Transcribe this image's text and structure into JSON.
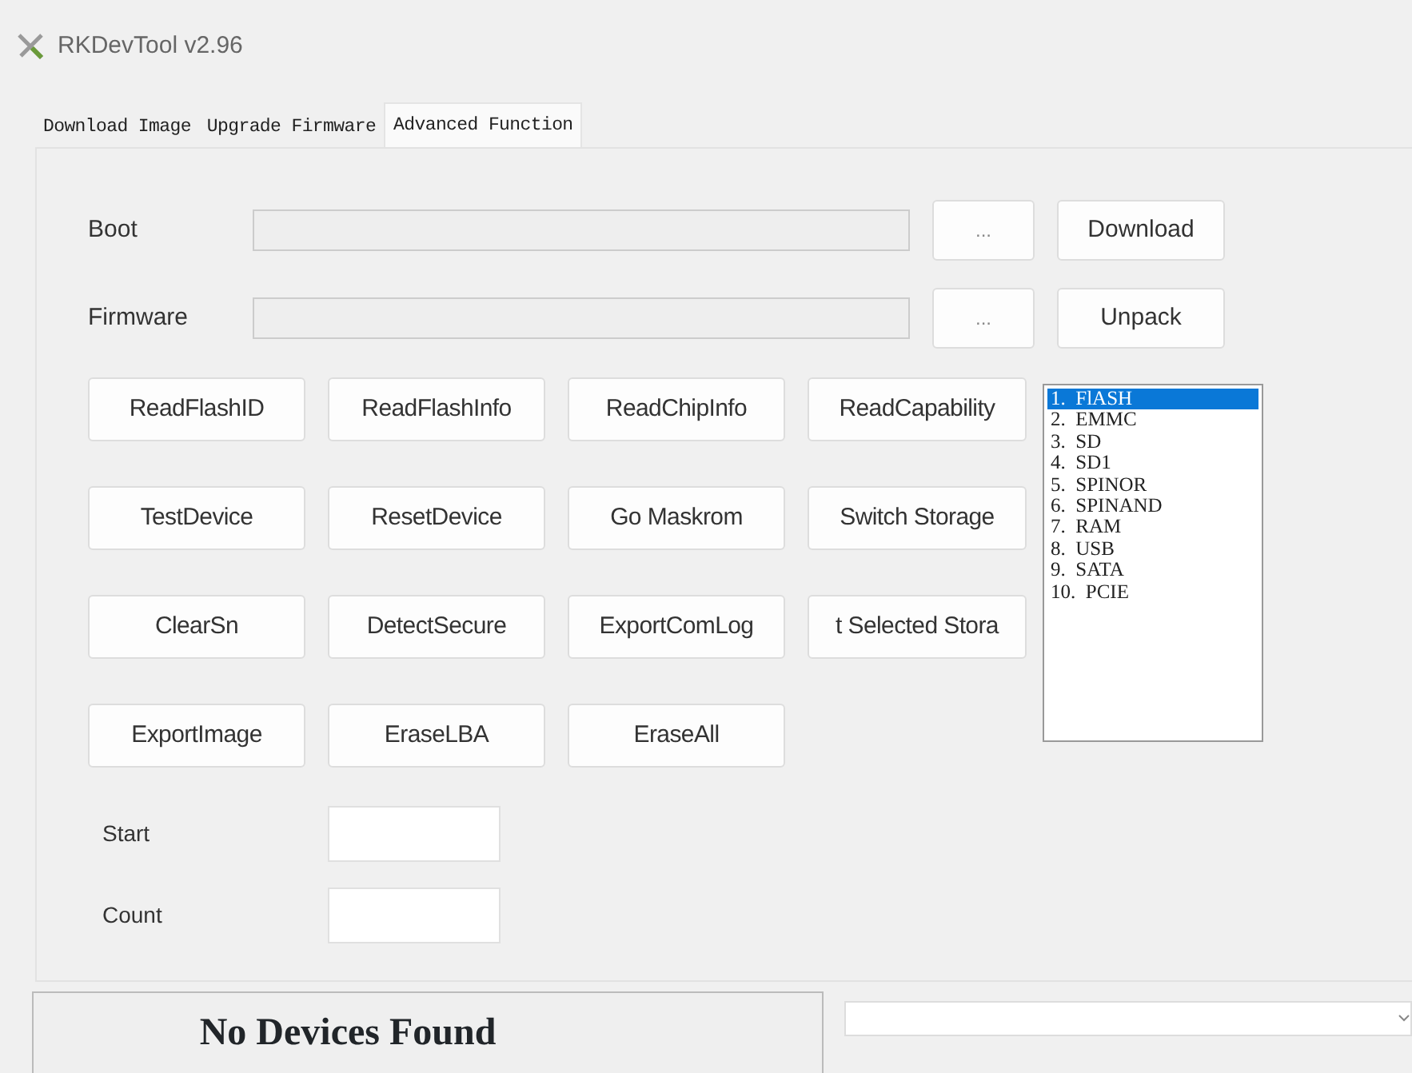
{
  "window": {
    "title": "RKDevTool v2.96"
  },
  "tabs": [
    {
      "label": "Download Image",
      "selected": false
    },
    {
      "label": "Upgrade Firmware",
      "selected": false
    },
    {
      "label": "Advanced Function",
      "selected": true
    }
  ],
  "file_rows": [
    {
      "label": "Boot",
      "browse": "...",
      "action": "Download"
    },
    {
      "label": "Firmware",
      "browse": "...",
      "action": "Unpack"
    }
  ],
  "function_buttons": [
    [
      "ReadFlashID",
      "ReadFlashInfo",
      "ReadChipInfo",
      "ReadCapability"
    ],
    [
      "TestDevice",
      "ResetDevice",
      "Go Maskrom",
      "Switch Storage"
    ],
    [
      "ClearSn",
      "DetectSecure",
      "ExportComLog",
      "t Selected Stora"
    ],
    [
      "ExportImage",
      "EraseLBA",
      "EraseAll"
    ]
  ],
  "storage_list": [
    {
      "label": "1.  FlASH",
      "selected": true
    },
    {
      "label": "2.  EMMC",
      "selected": false
    },
    {
      "label": "3.  SD",
      "selected": false
    },
    {
      "label": "4.  SD1",
      "selected": false
    },
    {
      "label": "5.  SPINOR",
      "selected": false
    },
    {
      "label": "6.  SPINAND",
      "selected": false
    },
    {
      "label": "7.  RAM",
      "selected": false
    },
    {
      "label": "8.  USB",
      "selected": false
    },
    {
      "label": "9.  SATA",
      "selected": false
    },
    {
      "label": "10.  PCIE",
      "selected": false
    }
  ],
  "lba_fields": [
    {
      "label": "Start"
    },
    {
      "label": "Count"
    }
  ],
  "status_bar": {
    "message": "No Devices Found"
  }
}
